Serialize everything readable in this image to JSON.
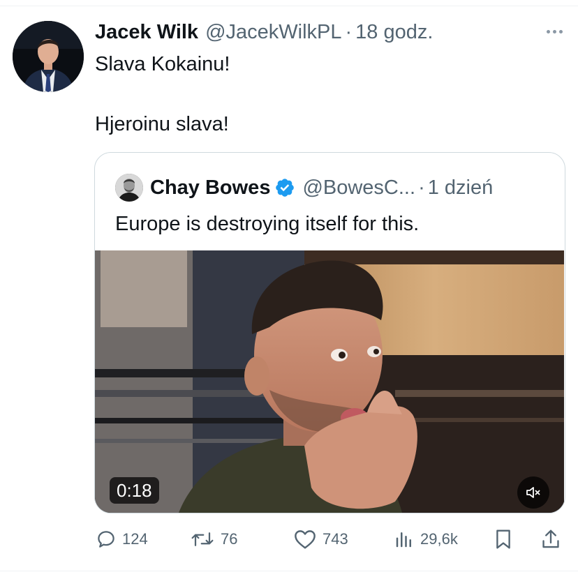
{
  "author": {
    "name": "Jacek Wilk",
    "handle": "@JacekWilkPL",
    "separator": "·",
    "time": "18 godz."
  },
  "tweet": {
    "line1": "Slava Kokainu!",
    "line2": "Hjeroinu slava!"
  },
  "quoted": {
    "name": "Chay Bowes",
    "handle": "@BowesC...",
    "separator": "·",
    "time": "1 dzień",
    "text": "Europe is destroying itself for this.",
    "video_duration": "0:18",
    "verified_color": "#1d9bf0"
  },
  "actions": {
    "replies": "124",
    "retweets": "76",
    "likes": "743",
    "views": "29,6k"
  },
  "icons": [
    "more-icon",
    "verified-badge-icon",
    "mute-icon",
    "reply-icon",
    "retweet-icon",
    "like-icon",
    "views-icon",
    "bookmark-icon",
    "share-icon"
  ],
  "colors": {
    "text": "#0f1419",
    "secondary": "#536471",
    "border": "#cfd9de"
  }
}
